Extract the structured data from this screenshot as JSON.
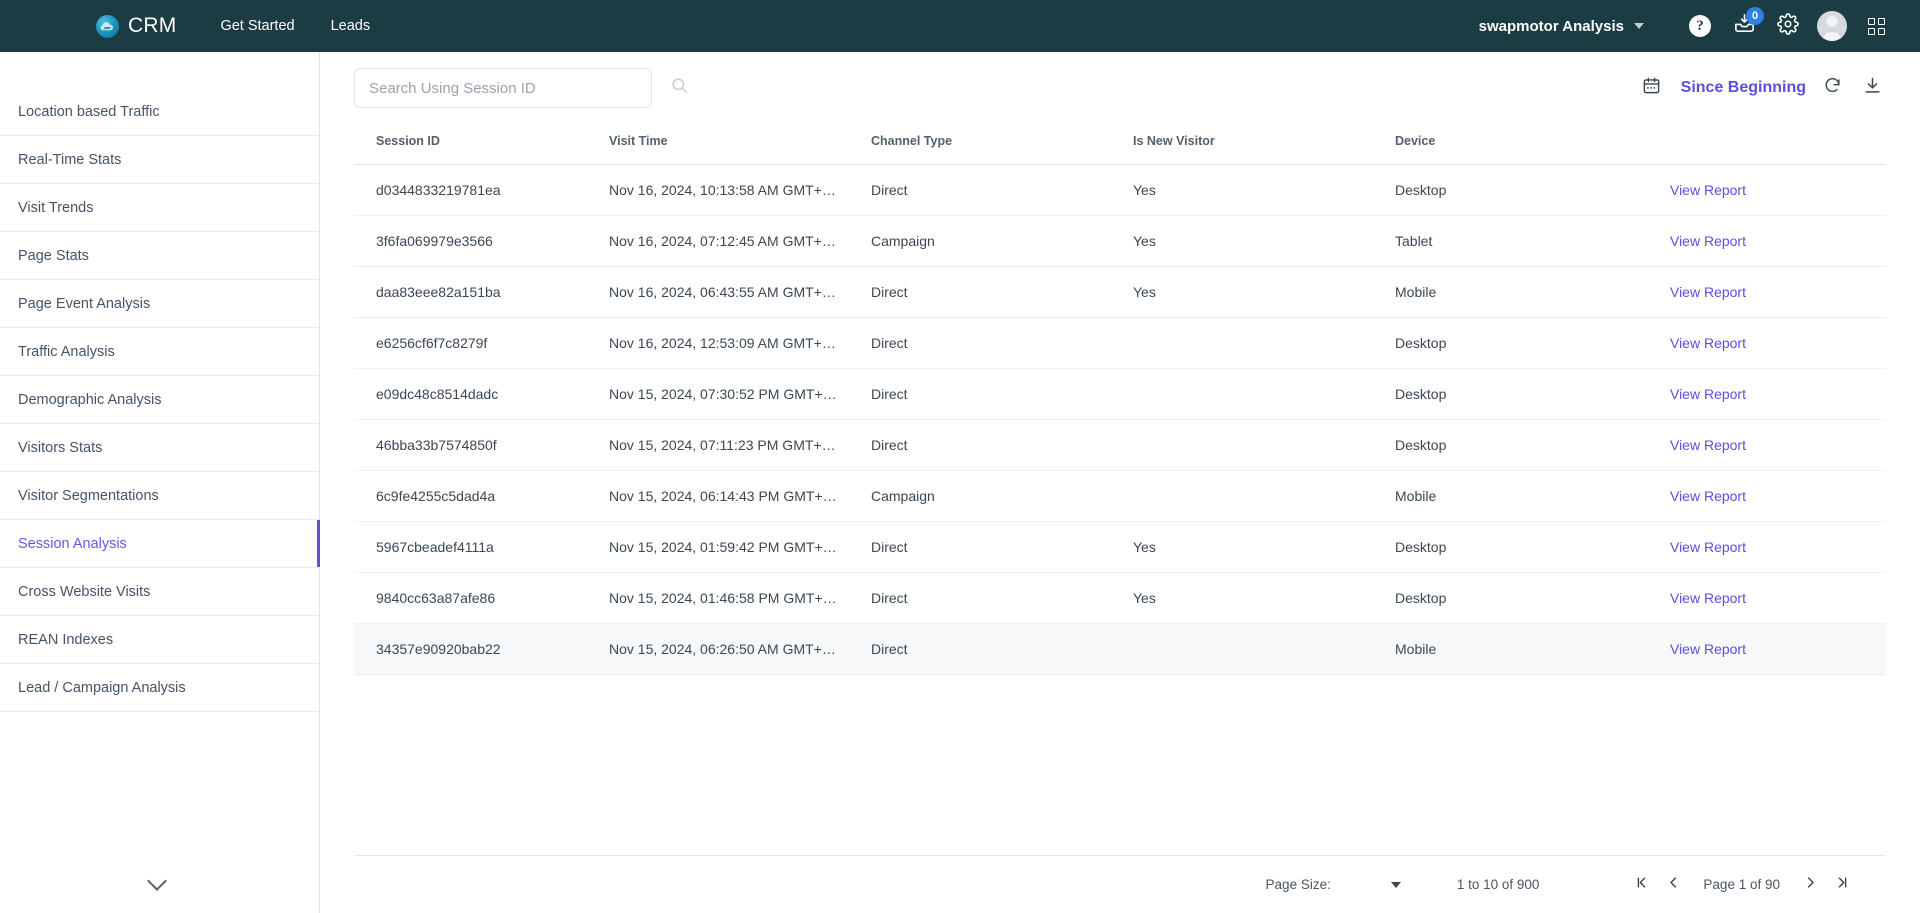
{
  "header": {
    "brand": "CRM",
    "logo_icon": "cloud-logo-icon",
    "nav": [
      {
        "label": "Get Started",
        "name": "nav-get-started"
      },
      {
        "label": "Leads",
        "name": "nav-leads"
      }
    ],
    "org_name": "swapmotor Analysis",
    "org_chevron_icon": "chevron-down-icon",
    "help_label": "?",
    "inbox_badge": "0",
    "icons": {
      "help": "help-icon",
      "inbox": "inbox-download-icon",
      "settings": "gear-icon",
      "avatar": "avatar-icon",
      "apps": "apps-grid-icon"
    }
  },
  "sidebar": {
    "items": [
      {
        "label": "Location based Traffic",
        "active": false
      },
      {
        "label": "Real-Time Stats",
        "active": false
      },
      {
        "label": "Visit Trends",
        "active": false
      },
      {
        "label": "Page Stats",
        "active": false
      },
      {
        "label": "Page Event Analysis",
        "active": false
      },
      {
        "label": "Traffic Analysis",
        "active": false
      },
      {
        "label": "Demographic Analysis",
        "active": false
      },
      {
        "label": "Visitors Stats",
        "active": false
      },
      {
        "label": "Visitor Segmentations",
        "active": false
      },
      {
        "label": "Session Analysis",
        "active": true
      },
      {
        "label": "Cross Website Visits",
        "active": false
      },
      {
        "label": "REAN Indexes",
        "active": false
      },
      {
        "label": "Lead / Campaign Analysis",
        "active": false
      }
    ],
    "expand_icon": "chevron-down-icon"
  },
  "toolbar": {
    "search_placeholder": "Search Using Session ID",
    "search_value": "",
    "search_icon": "search-icon",
    "calendar_icon": "calendar-icon",
    "date_range_label": "Since Beginning",
    "refresh_icon": "refresh-icon",
    "download_icon": "download-icon",
    "accent_color": "#5a4fe0"
  },
  "table": {
    "columns": [
      "Session ID",
      "Visit Time",
      "Channel Type",
      "Is New Visitor",
      "Device",
      ""
    ],
    "action_label": "View Report",
    "rows": [
      {
        "session_id": "d0344833219781ea",
        "visit_time": "Nov 16, 2024, 10:13:58 AM GMT+…",
        "channel_type": "Direct",
        "is_new_visitor": "Yes",
        "device": "Desktop",
        "action": "View Report",
        "highlighted": false
      },
      {
        "session_id": "3f6fa069979e3566",
        "visit_time": "Nov 16, 2024, 07:12:45 AM GMT+…",
        "channel_type": "Campaign",
        "is_new_visitor": "Yes",
        "device": "Tablet",
        "action": "View Report",
        "highlighted": false
      },
      {
        "session_id": "daa83eee82a151ba",
        "visit_time": "Nov 16, 2024, 06:43:55 AM GMT+…",
        "channel_type": "Direct",
        "is_new_visitor": "Yes",
        "device": "Mobile",
        "action": "View Report",
        "highlighted": false
      },
      {
        "session_id": "e6256cf6f7c8279f",
        "visit_time": "Nov 16, 2024, 12:53:09 AM GMT+…",
        "channel_type": "Direct",
        "is_new_visitor": "",
        "device": "Desktop",
        "action": "View Report",
        "highlighted": false
      },
      {
        "session_id": "e09dc48c8514dadc",
        "visit_time": "Nov 15, 2024, 07:30:52 PM GMT+…",
        "channel_type": "Direct",
        "is_new_visitor": "",
        "device": "Desktop",
        "action": "View Report",
        "highlighted": false
      },
      {
        "session_id": "46bba33b7574850f",
        "visit_time": "Nov 15, 2024, 07:11:23 PM GMT+…",
        "channel_type": "Direct",
        "is_new_visitor": "",
        "device": "Desktop",
        "action": "View Report",
        "highlighted": false
      },
      {
        "session_id": "6c9fe4255c5dad4a",
        "visit_time": "Nov 15, 2024, 06:14:43 PM GMT+…",
        "channel_type": "Campaign",
        "is_new_visitor": "",
        "device": "Mobile",
        "action": "View Report",
        "highlighted": false
      },
      {
        "session_id": "5967cbeadef4111a",
        "visit_time": "Nov 15, 2024, 01:59:42 PM GMT+…",
        "channel_type": "Direct",
        "is_new_visitor": "Yes",
        "device": "Desktop",
        "action": "View Report",
        "highlighted": false
      },
      {
        "session_id": "9840cc63a87afe86",
        "visit_time": "Nov 15, 2024, 01:46:58 PM GMT+…",
        "channel_type": "Direct",
        "is_new_visitor": "Yes",
        "device": "Desktop",
        "action": "View Report",
        "highlighted": false
      },
      {
        "session_id": "34357e90920bab22",
        "visit_time": "Nov 15, 2024, 06:26:50 AM GMT+…",
        "channel_type": "Direct",
        "is_new_visitor": "",
        "device": "Mobile",
        "action": "View Report",
        "highlighted": true
      }
    ]
  },
  "pagination": {
    "page_size_label": "Page Size:",
    "page_size_value": "",
    "range_text": "1 to 10 of 900",
    "page_text": "Page 1 of 90",
    "first_icon": "first-page-icon",
    "prev_icon": "previous-page-icon",
    "next_icon": "next-page-icon",
    "last_icon": "last-page-icon"
  }
}
